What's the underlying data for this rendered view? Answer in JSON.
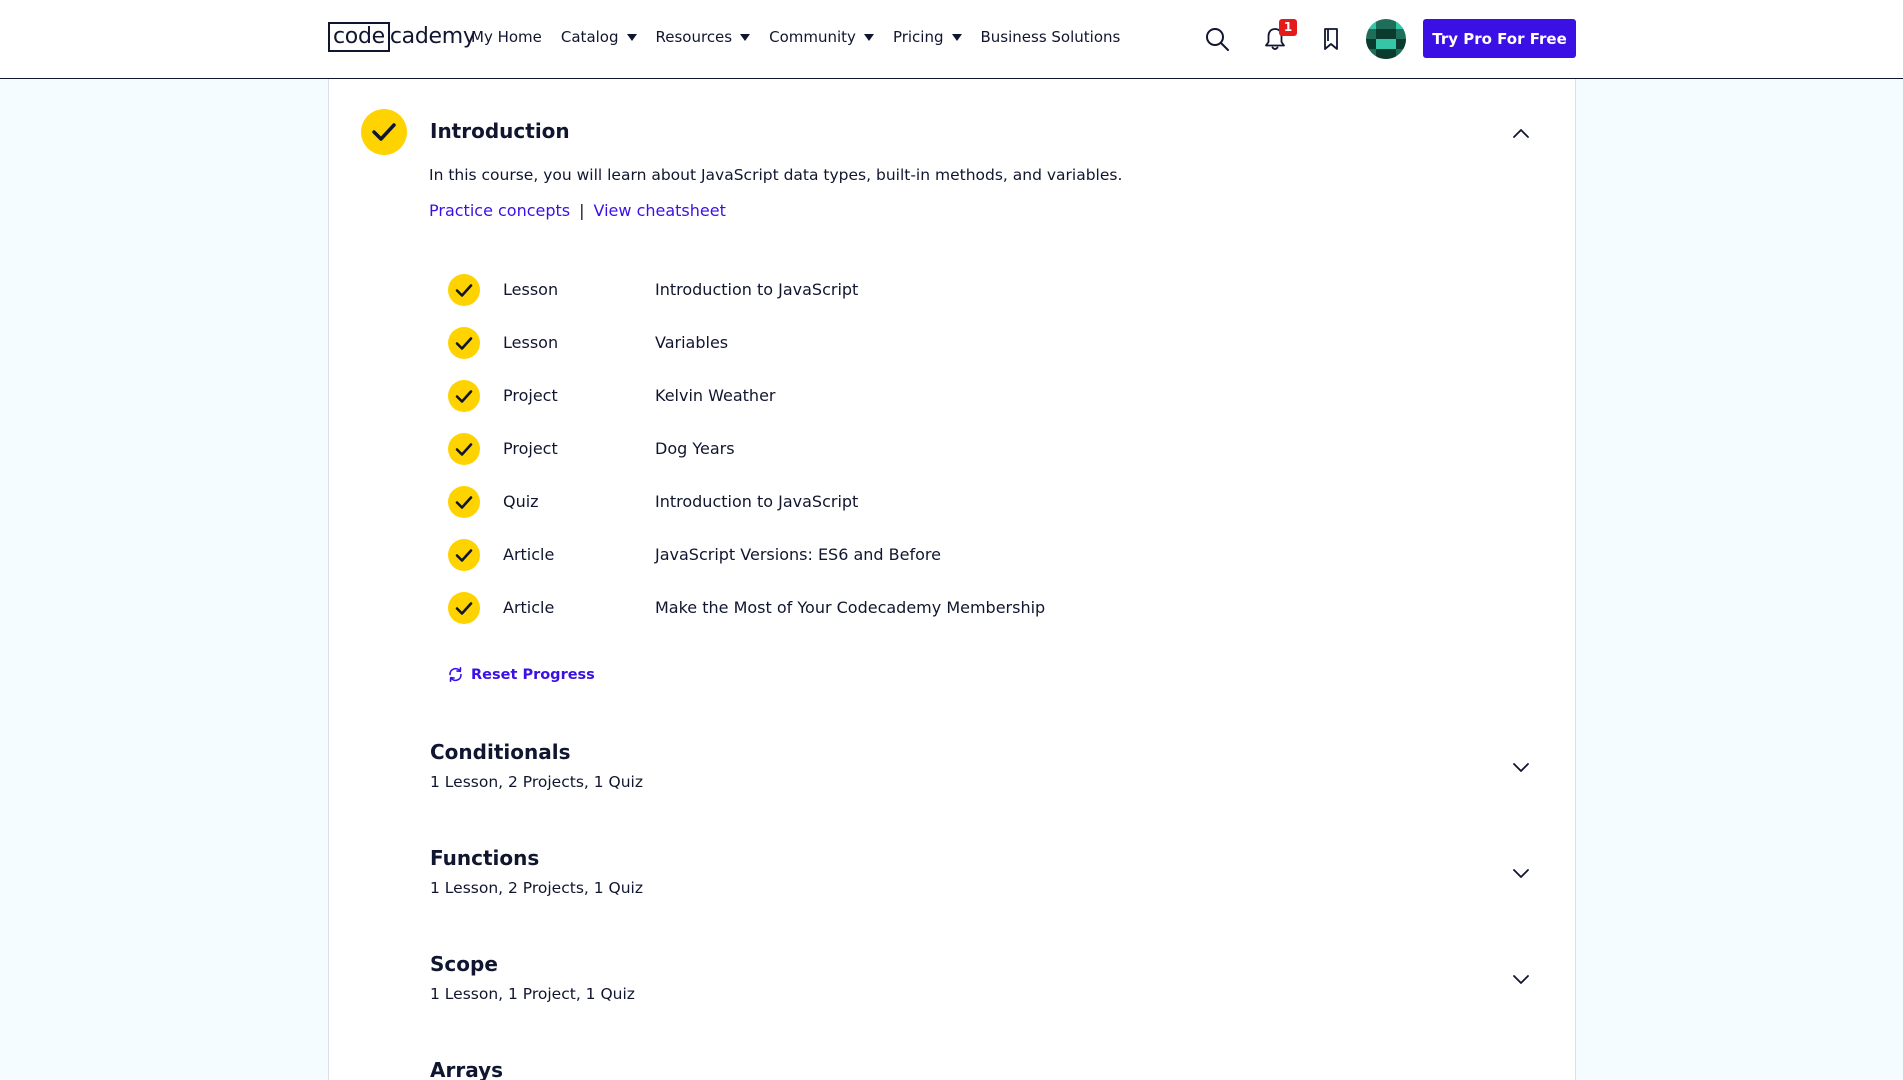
{
  "header": {
    "logo": {
      "part1": "code",
      "part2": "cademy"
    },
    "nav": [
      {
        "label": "My Home",
        "dropdown": false
      },
      {
        "label": "Catalog",
        "dropdown": true
      },
      {
        "label": "Resources",
        "dropdown": true
      },
      {
        "label": "Community",
        "dropdown": true
      },
      {
        "label": "Pricing",
        "dropdown": true
      },
      {
        "label": "Business Solutions",
        "dropdown": false
      }
    ],
    "notification_count": "1",
    "cta_label": "Try Pro For Free"
  },
  "intro": {
    "title": "Introduction",
    "description": "In this course, you will learn about JavaScript data types, built-in methods, and variables.",
    "link_practice": "Practice concepts",
    "link_separator": "|",
    "link_cheatsheet": "View cheatsheet",
    "items": [
      {
        "type": "Lesson",
        "name": "Introduction to JavaScript"
      },
      {
        "type": "Lesson",
        "name": "Variables"
      },
      {
        "type": "Project",
        "name": "Kelvin Weather"
      },
      {
        "type": "Project",
        "name": "Dog Years"
      },
      {
        "type": "Quiz",
        "name": "Introduction to JavaScript"
      },
      {
        "type": "Article",
        "name": "JavaScript Versions: ES6 and Before"
      },
      {
        "type": "Article",
        "name": "Make the Most of Your Codecademy Membership"
      }
    ],
    "reset_label": "Reset Progress"
  },
  "modules": [
    {
      "title": "Conditionals",
      "summary": "1 Lesson, 2 Projects, 1 Quiz"
    },
    {
      "title": "Functions",
      "summary": "1 Lesson, 2 Projects, 1 Quiz"
    },
    {
      "title": "Scope",
      "summary": "1 Lesson, 1 Project, 1 Quiz"
    },
    {
      "title": "Arrays",
      "summary": ""
    }
  ],
  "colors": {
    "accent": "#3a10e5",
    "check": "#ffd300",
    "ink": "#10162f",
    "badge": "#e31b1b",
    "page_bg": "#f5fcff"
  },
  "icons": {
    "search": "search-icon",
    "bell": "bell-icon",
    "bookmark": "bookmark-icon",
    "check": "check-icon",
    "chevron_up": "chevron-up-icon",
    "chevron_down": "chevron-down-icon",
    "reset": "refresh-icon"
  }
}
